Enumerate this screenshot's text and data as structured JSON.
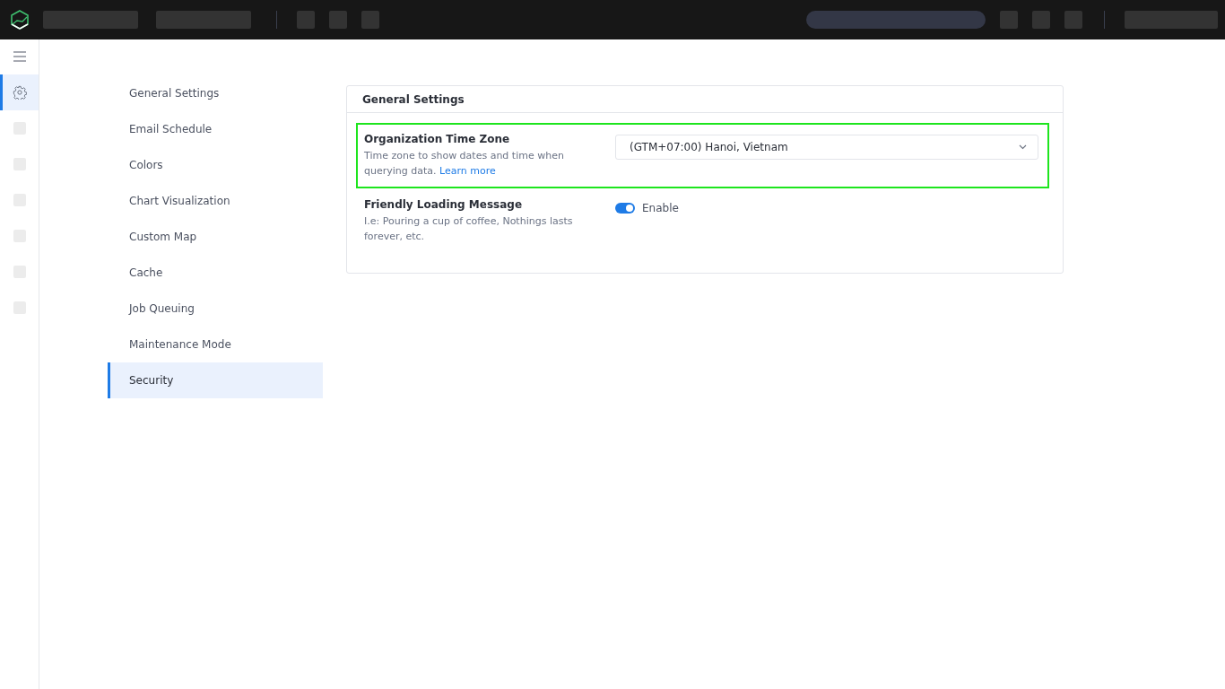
{
  "rail": {
    "items": [
      {
        "kind": "gear",
        "selected": true
      },
      {
        "kind": "blank",
        "selected": false
      },
      {
        "kind": "blank",
        "selected": false
      },
      {
        "kind": "blank",
        "selected": false
      },
      {
        "kind": "blank",
        "selected": false
      },
      {
        "kind": "blank",
        "selected": false
      },
      {
        "kind": "blank",
        "selected": false
      }
    ]
  },
  "nav": {
    "items": [
      {
        "label": "General Settings",
        "selected": false
      },
      {
        "label": "Email Schedule",
        "selected": false
      },
      {
        "label": "Colors",
        "selected": false
      },
      {
        "label": "Chart Visualization",
        "selected": false
      },
      {
        "label": "Custom Map",
        "selected": false
      },
      {
        "label": "Cache",
        "selected": false
      },
      {
        "label": "Job Queuing",
        "selected": false
      },
      {
        "label": "Maintenance Mode",
        "selected": false
      },
      {
        "label": "Security",
        "selected": true
      }
    ]
  },
  "panel": {
    "title": "General Settings",
    "settings": [
      {
        "kind": "select",
        "label": "Organization Time Zone",
        "description": "Time zone to show dates and time when querying data.",
        "link": "Learn more",
        "value": "(GTM+07:00) Hanoi, Vietnam",
        "highlighted": true
      },
      {
        "kind": "toggle",
        "label": "Friendly Loading Message",
        "description": "I.e: Pouring a cup of coffee, Nothings lasts forever, etc.",
        "toggle_label": "Enable",
        "on": true,
        "highlighted": false
      }
    ]
  }
}
